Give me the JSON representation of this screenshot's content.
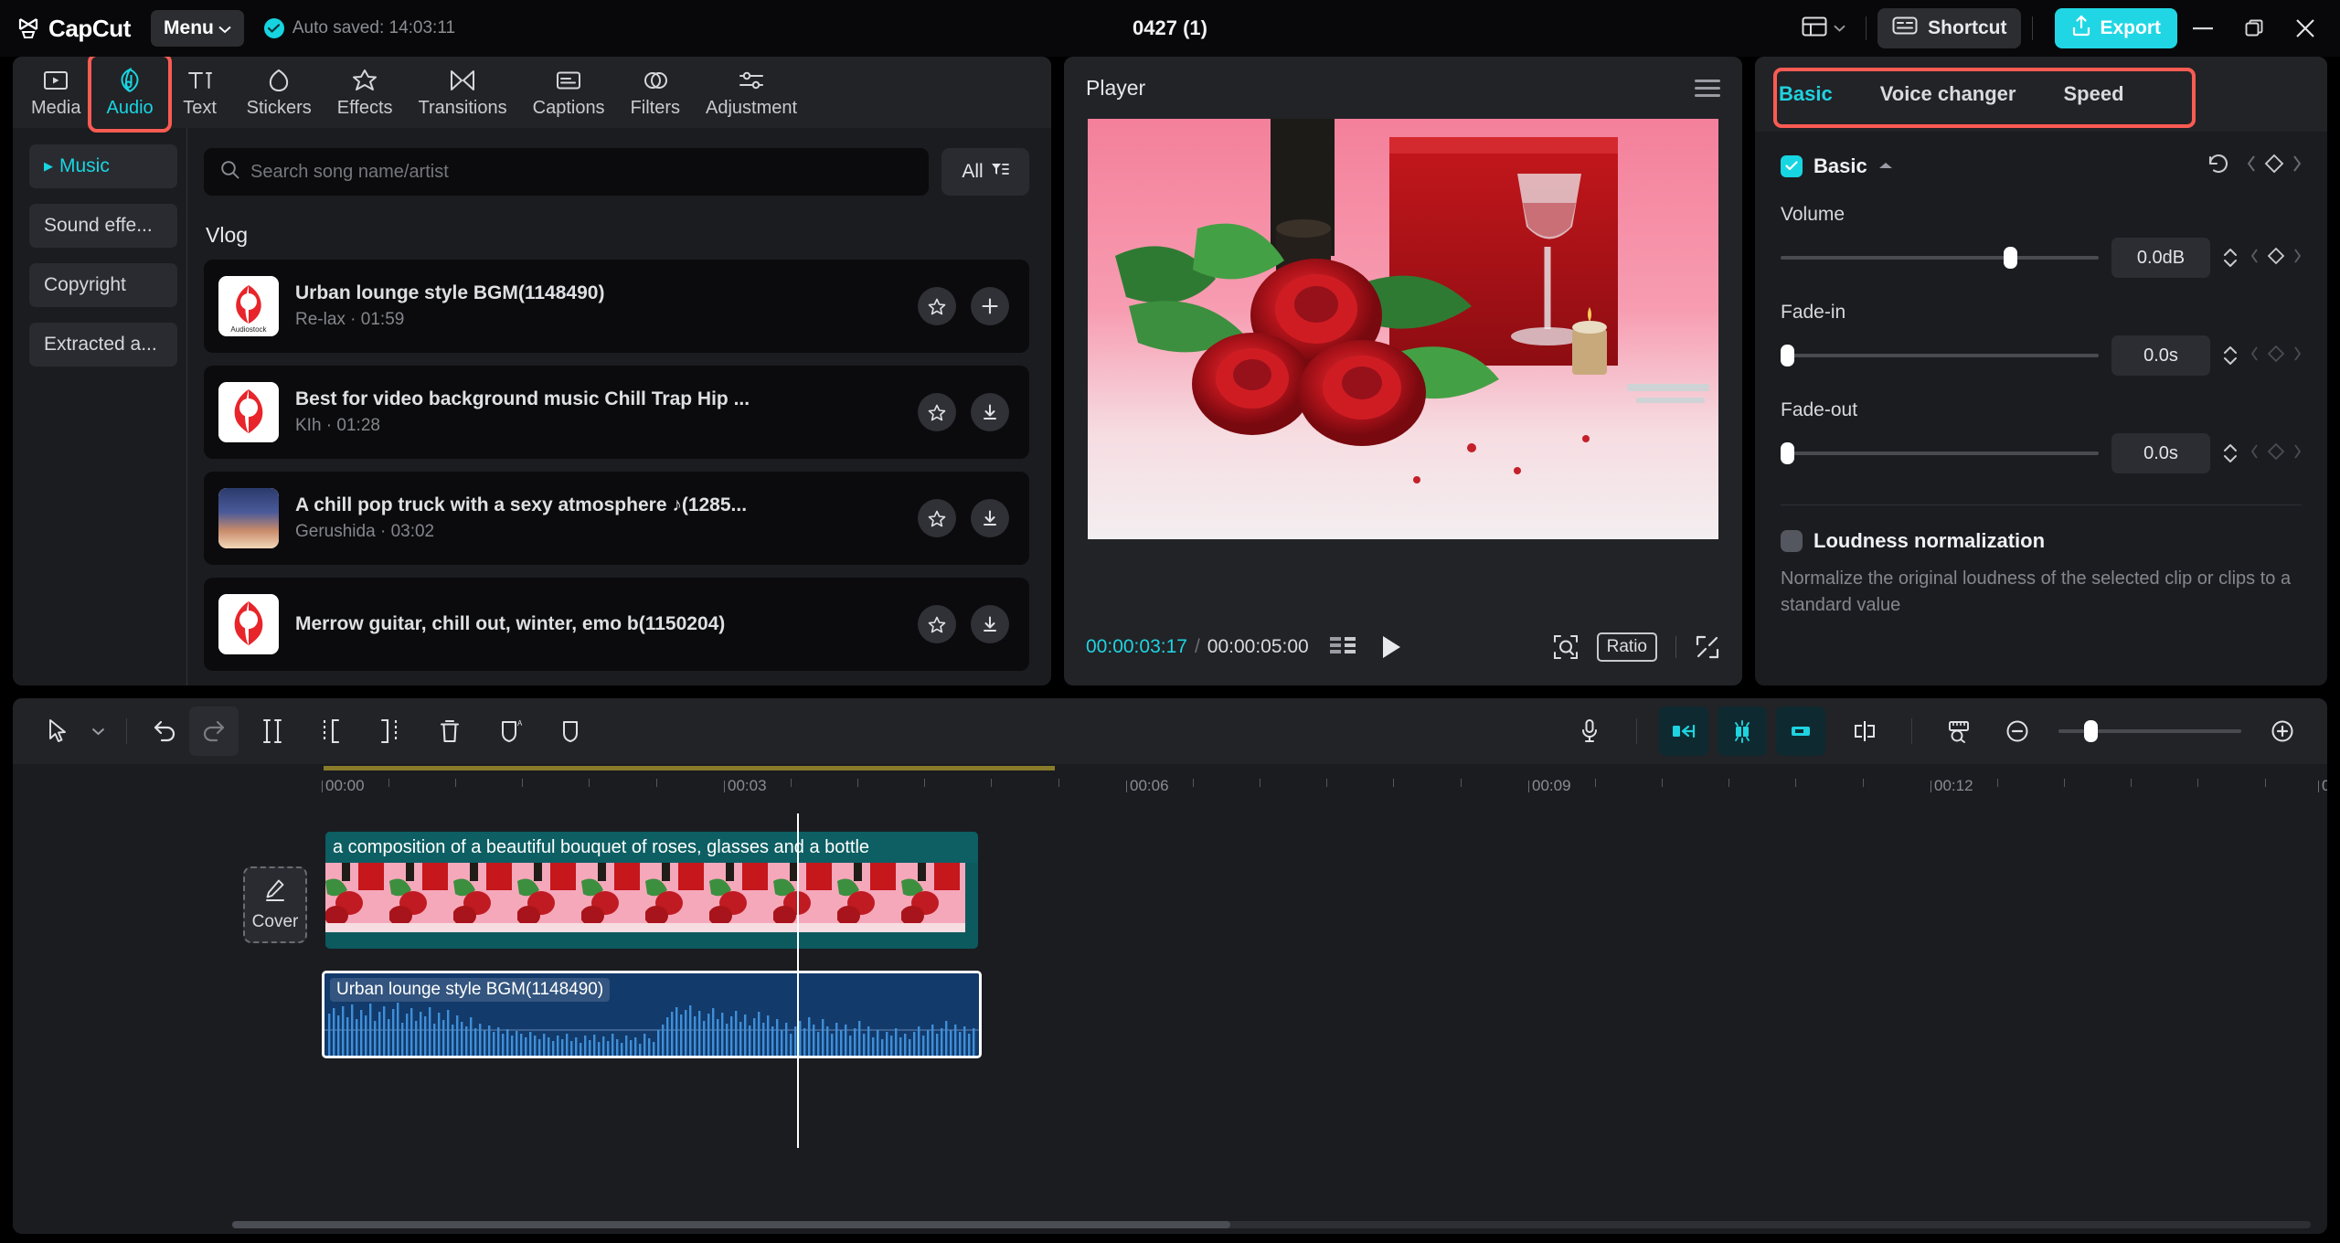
{
  "titlebar": {
    "brand": "CapCut",
    "menu_label": "Menu",
    "autosave_text": "Auto saved: 14:03:11",
    "project_title": "0427 (1)",
    "shortcut_label": "Shortcut",
    "export_label": "Export",
    "icons": {
      "logo": "capcut-logo-icon",
      "chevron": "chevron-down-icon",
      "check": "check-icon",
      "layout": "layout-grid-icon",
      "shortcut": "keyboard-icon",
      "export": "upload-icon",
      "minimize": "minimize-icon",
      "maximize": "restore-icon",
      "close": "close-icon"
    }
  },
  "left_panel": {
    "tabs": [
      {
        "label": "Media",
        "icon": "media-play-icon",
        "active": false,
        "highlighted": false
      },
      {
        "label": "Audio",
        "icon": "audio-note-icon",
        "active": true,
        "highlighted": true
      },
      {
        "label": "Text",
        "icon": "text-ti-icon",
        "active": false,
        "highlighted": false
      },
      {
        "label": "Stickers",
        "icon": "sticker-icon",
        "active": false,
        "highlighted": false
      },
      {
        "label": "Effects",
        "icon": "effects-star-icon",
        "active": false,
        "highlighted": false
      },
      {
        "label": "Transitions",
        "icon": "transitions-icon",
        "active": false,
        "highlighted": false
      },
      {
        "label": "Captions",
        "icon": "captions-icon",
        "active": false,
        "highlighted": false
      },
      {
        "label": "Filters",
        "icon": "filters-icon",
        "active": false,
        "highlighted": false
      },
      {
        "label": "Adjustment",
        "icon": "adjustment-sliders-icon",
        "active": false,
        "highlighted": false
      }
    ],
    "categories": [
      {
        "label": "Music",
        "active": true
      },
      {
        "label": "Sound effe...",
        "active": false
      },
      {
        "label": "Copyright",
        "active": false
      },
      {
        "label": "Extracted a...",
        "active": false
      }
    ],
    "search": {
      "placeholder": "Search song name/artist",
      "value": ""
    },
    "filter_label": "All",
    "section_title": "Vlog",
    "songs": [
      {
        "title": "Urban lounge style BGM(1148490)",
        "artist": "Re-lax",
        "duration": "01:59",
        "thumb": "audiostock-red",
        "action": "add"
      },
      {
        "title": "Best for video background music Chill Trap Hip ...",
        "artist": "KIh",
        "duration": "01:28",
        "thumb": "red",
        "action": "download"
      },
      {
        "title": "A chill pop truck with a sexy atmosphere ♪(1285...",
        "artist": "Gerushida",
        "duration": "03:02",
        "thumb": "sunset",
        "action": "download"
      },
      {
        "title": "Merrow guitar, chill out, winter, emo b(1150204)",
        "artist": "",
        "duration": "",
        "thumb": "red",
        "action": "download"
      }
    ]
  },
  "player": {
    "title": "Player",
    "current_time": "00:00:03:17",
    "total_time": "00:00:05:00",
    "ratio_label": "Ratio",
    "icons": {
      "menu": "hamburger-icon",
      "frames": "frame-grid-icon",
      "play": "play-icon",
      "zoom": "zoom-fit-icon",
      "fullscreen": "fullscreen-icon"
    }
  },
  "right_panel": {
    "tabs": [
      {
        "label": "Basic",
        "active": true
      },
      {
        "label": "Voice changer",
        "active": false
      },
      {
        "label": "Speed",
        "active": false
      }
    ],
    "section": {
      "title": "Basic",
      "checked": true
    },
    "properties": [
      {
        "label": "Volume",
        "value": "0.0dB",
        "knob_pct": 72
      },
      {
        "label": "Fade-in",
        "value": "0.0s",
        "knob_pct": 0
      },
      {
        "label": "Fade-out",
        "value": "0.0s",
        "knob_pct": 0
      }
    ],
    "loudness": {
      "title": "Loudness normalization",
      "description": "Normalize the original loudness of the selected clip or clips to a standard value",
      "enabled": false
    },
    "icons": {
      "reset": "reset-icon",
      "keyframe": "keyframe-diamond-icon",
      "collapse": "chevron-up-icon"
    }
  },
  "timeline": {
    "tools_left": [
      {
        "name": "select-cursor-icon",
        "boxed": false
      },
      {
        "name": "chevron-down-icon",
        "boxed": false
      },
      {
        "name": "undo-icon",
        "boxed": false
      },
      {
        "name": "redo-icon",
        "boxed": true
      },
      {
        "name": "split-icon",
        "boxed": false
      },
      {
        "name": "trim-left-icon",
        "boxed": false
      },
      {
        "name": "trim-right-icon",
        "boxed": false
      },
      {
        "name": "delete-trash-icon",
        "boxed": false
      },
      {
        "name": "ai-mask-icon",
        "boxed": false
      },
      {
        "name": "mask-icon",
        "boxed": false
      }
    ],
    "tools_right": [
      {
        "name": "microphone-icon",
        "style": "plain"
      },
      {
        "name": "snap-left-icon",
        "style": "cyan-box"
      },
      {
        "name": "snap-center-icon",
        "style": "cyan-box"
      },
      {
        "name": "snap-right-icon",
        "style": "cyan-box"
      },
      {
        "name": "split-clip-icon",
        "style": "plain"
      },
      {
        "name": "ruler-zoom-icon",
        "style": "plain"
      },
      {
        "name": "zoom-out-icon",
        "style": "plain"
      },
      {
        "name": "zoom-in-icon",
        "style": "plain"
      }
    ],
    "ruler_ticks": [
      "00:00",
      "00:03",
      "00:06",
      "00:09",
      "00:12",
      "0"
    ],
    "playhead_time": "00:00:03:17",
    "video_track": {
      "clip_label": "a composition of a beautiful bouquet of roses, glasses and a bottle",
      "cover_label": "Cover",
      "controls": [
        "track-thumbnail-icon",
        "lock-icon",
        "eye-icon",
        "volume-icon"
      ]
    },
    "audio_track": {
      "clip_label": "Urban lounge style BGM(1148490)",
      "controls": [
        "audio-note-icon",
        "lock-icon",
        "volume-icon"
      ],
      "selected": true
    }
  },
  "colors": {
    "accent": "#18d5e2",
    "highlight": "#fa5b52",
    "video_clip": "#0c5a5e",
    "audio_clip": "#123a6b",
    "panel_bg": "#1b1c20"
  }
}
